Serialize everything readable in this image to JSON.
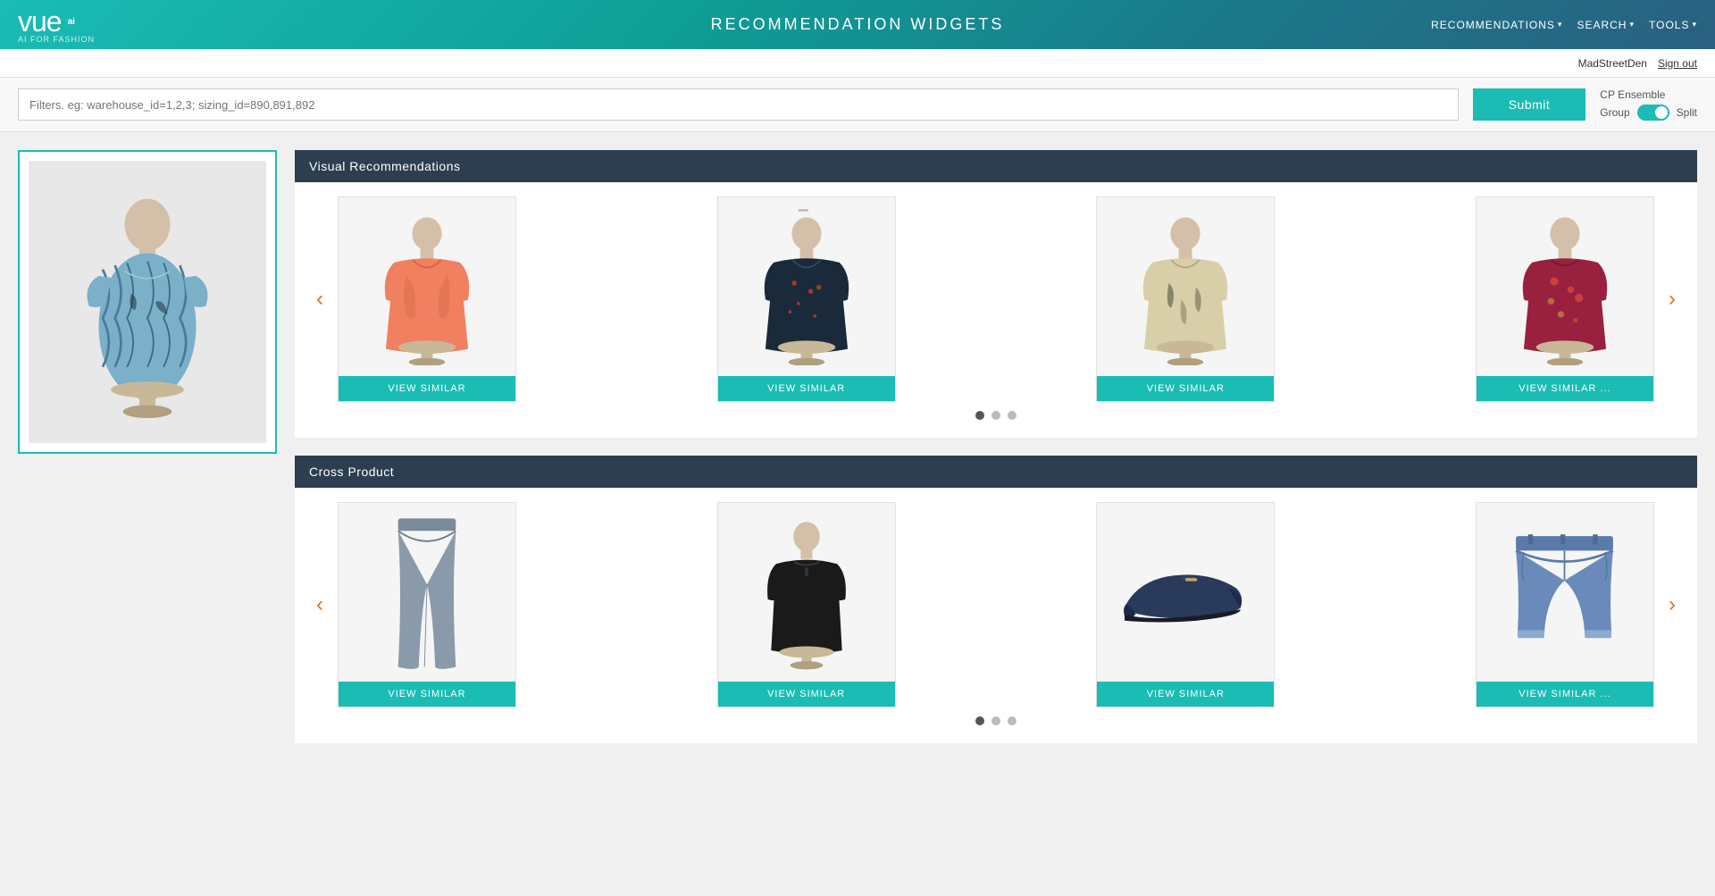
{
  "header": {
    "logo_vue": "vue",
    "logo_ai": "ai",
    "logo_sub": "AI FOR FASHION",
    "title": "RECOMMENDATION  WIDGETS",
    "nav": [
      {
        "id": "recommendations",
        "label": "RECOMMENDATIONS",
        "has_arrow": true
      },
      {
        "id": "search",
        "label": "SEARCH",
        "has_arrow": true
      },
      {
        "id": "tools",
        "label": "TOOLS",
        "has_arrow": true
      }
    ]
  },
  "user_bar": {
    "username": "MadStreetDen",
    "sign_out": "Sign out"
  },
  "filter_bar": {
    "input_placeholder": "Filters. eg: warehouse_id=1,2,3; sizing_id=890,891,892",
    "submit_label": "Submit",
    "toggle_label1": "CP Ensemble",
    "toggle_label2": "Split",
    "toggle_group_label": "Group"
  },
  "sections": [
    {
      "id": "visual-recommendations",
      "title": "Visual Recommendations",
      "products": [
        {
          "id": "vr1",
          "label": "VIEW SIMILAR",
          "color": "#f08060",
          "type": "blouse-salmon"
        },
        {
          "id": "vr2",
          "label": "VIEW SIMILAR",
          "color": "#1a2a3a",
          "type": "blouse-dark"
        },
        {
          "id": "vr3",
          "label": "VIEW SIMILAR",
          "color": "#c8c0a0",
          "type": "blouse-beige"
        },
        {
          "id": "vr4",
          "label": "VIEW SIMILAR ...",
          "color": "#9a2040",
          "type": "blouse-red"
        }
      ],
      "dots": [
        {
          "active": true
        },
        {
          "active": false
        },
        {
          "active": false
        }
      ]
    },
    {
      "id": "cross-product",
      "title": "Cross Product",
      "products": [
        {
          "id": "cp1",
          "label": "VIEW SIMILAR",
          "color": "#6a7a8a",
          "type": "pants"
        },
        {
          "id": "cp2",
          "label": "VIEW SIMILAR",
          "color": "#1a1a1a",
          "type": "blouse-black"
        },
        {
          "id": "cp3",
          "label": "VIEW SIMILAR",
          "color": "#2a3a5a",
          "type": "shoes"
        },
        {
          "id": "cp4",
          "label": "VIEW SIMILAR ...",
          "color": "#4a6a9a",
          "type": "shorts"
        }
      ],
      "dots": [
        {
          "active": true
        },
        {
          "active": false
        },
        {
          "active": false
        }
      ]
    }
  ]
}
